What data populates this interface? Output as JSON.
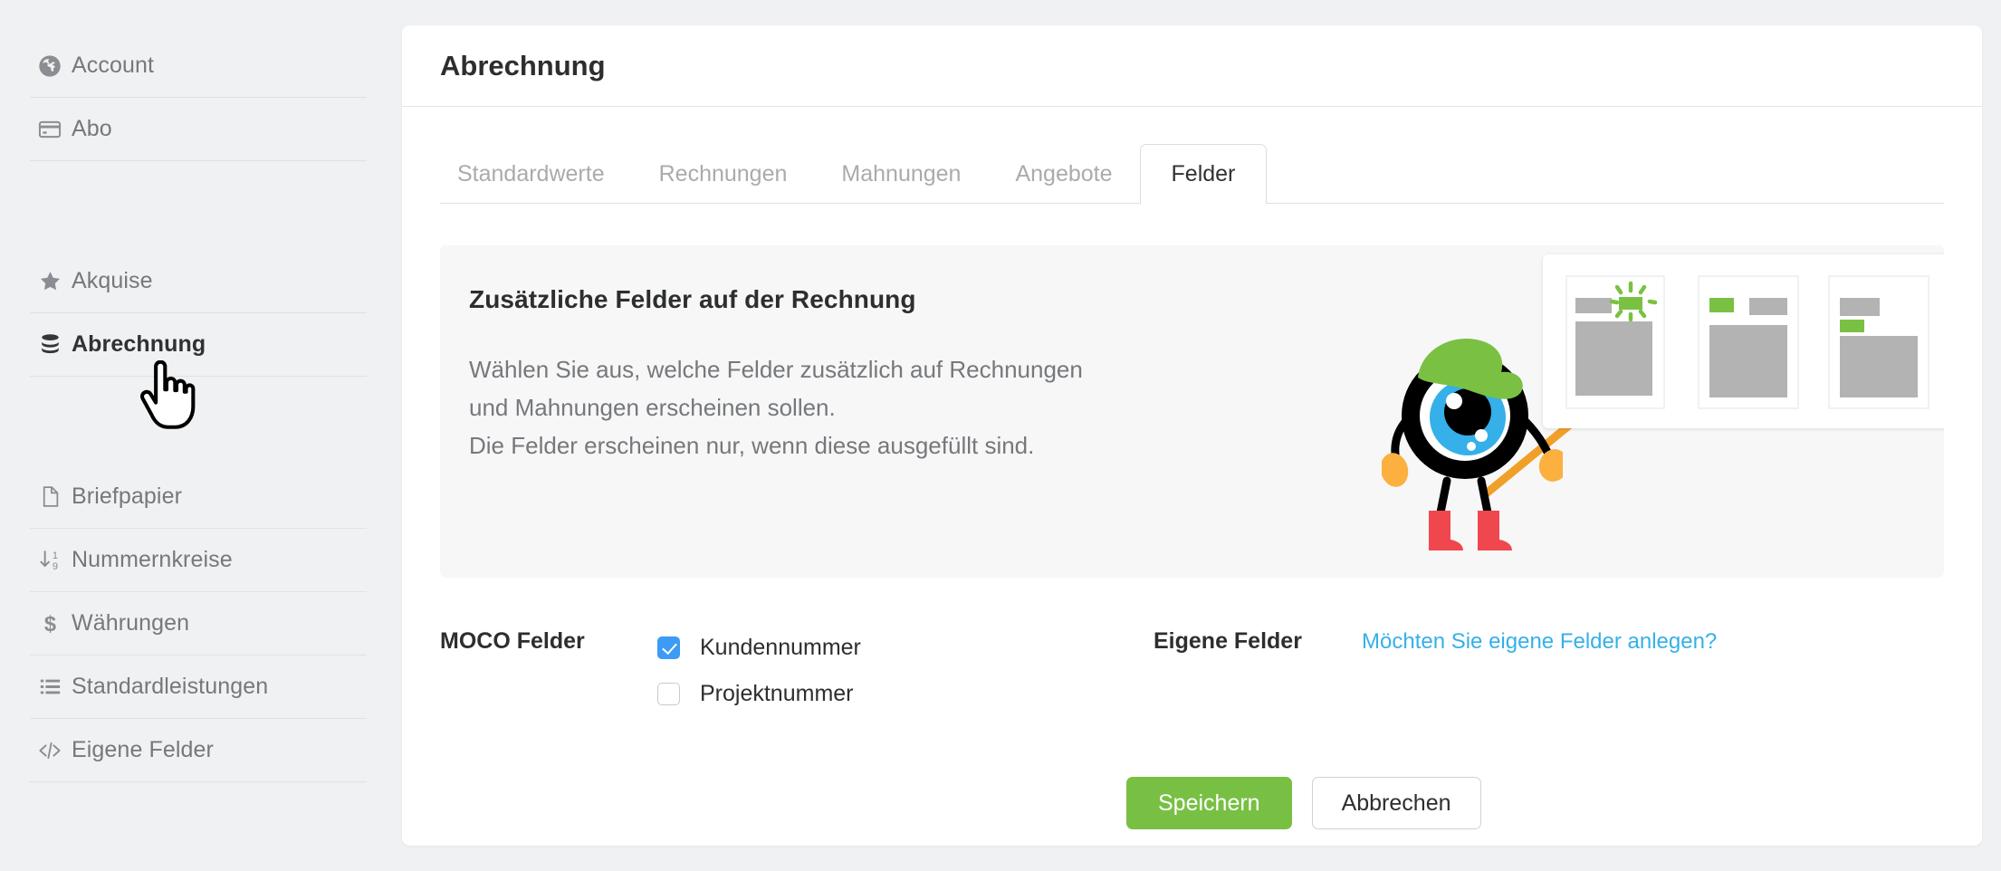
{
  "sidebar": {
    "groups": [
      {
        "items": [
          {
            "label": "Account",
            "icon": "globe-icon",
            "active": false
          },
          {
            "label": "Abo",
            "icon": "credit-card-icon",
            "active": false
          }
        ]
      },
      {
        "items": [
          {
            "label": "Akquise",
            "icon": "star-icon",
            "active": false
          },
          {
            "label": "Abrechnung",
            "icon": "database-icon",
            "active": true
          }
        ]
      },
      {
        "items": [
          {
            "label": "Briefpapier",
            "icon": "document-icon",
            "active": false
          },
          {
            "label": "Nummernkreise",
            "icon": "number-range-icon",
            "active": false
          },
          {
            "label": "Währungen",
            "icon": "dollar-icon",
            "active": false
          },
          {
            "label": "Standardleistungen",
            "icon": "list-icon",
            "active": false
          },
          {
            "label": "Eigene Felder",
            "icon": "code-icon",
            "active": false
          }
        ]
      }
    ]
  },
  "header": {
    "title": "Abrechnung"
  },
  "tabs": [
    {
      "label": "Standardwerte",
      "active": false
    },
    {
      "label": "Rechnungen",
      "active": false
    },
    {
      "label": "Mahnungen",
      "active": false
    },
    {
      "label": "Angebote",
      "active": false
    },
    {
      "label": "Felder",
      "active": true
    }
  ],
  "info": {
    "title": "Zusätzliche Felder auf der Rechnung",
    "line1": "Wählen Sie aus, welche Felder zusätzlich auf Rechnungen",
    "line2": "und Mahnungen erscheinen sollen.",
    "line3": "Die Felder erscheinen nur, wenn diese ausgefüllt sind."
  },
  "form": {
    "moco_label": "MOCO Felder",
    "checkboxes": [
      {
        "label": "Kundennummer",
        "checked": true
      },
      {
        "label": "Projektnummer",
        "checked": false
      }
    ],
    "own_label": "Eigene Felder",
    "own_link": "Möchten Sie eigene Felder anlegen?"
  },
  "buttons": {
    "save": "Speichern",
    "cancel": "Abbrechen"
  },
  "colors": {
    "accent_green": "#78c043",
    "link_blue": "#36b0e8",
    "checkbox_blue": "#3b9bf5",
    "mascot_cap_green": "#7ac143",
    "mascot_eye_blue": "#35b0e8",
    "mascot_boot_red": "#f0474f",
    "mascot_hand_yellow": "#fbb040"
  }
}
